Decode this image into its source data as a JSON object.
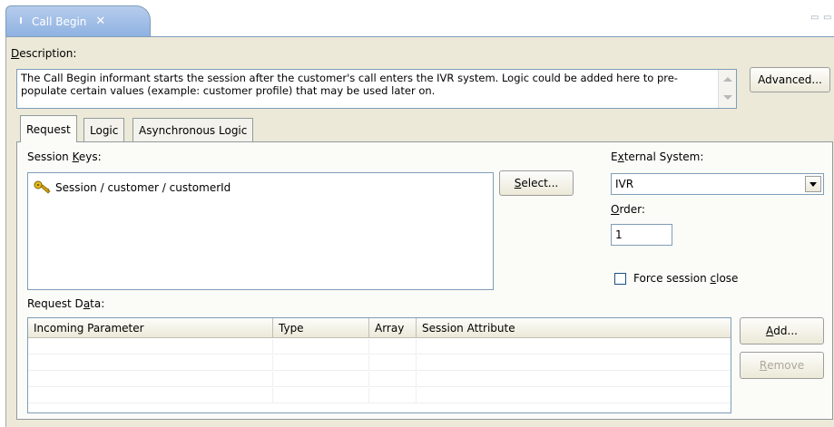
{
  "editor": {
    "tab_title": "Call Begin",
    "close_glyph": "✕",
    "minimize_glyph": "▭",
    "maximize_glyph": "▭"
  },
  "description": {
    "label_mnemonic": "D",
    "label_rest": "escription:",
    "text": "The Call Begin informant starts the session after the customer's call  enters the IVR system.  Logic could be added here to pre-populate certain values (example: customer profile) that may be used later on.",
    "advanced_button": "Advanced..."
  },
  "tabs": [
    {
      "label": "Request",
      "active": true
    },
    {
      "label": "Logic",
      "active": false
    },
    {
      "label": "Asynchronous Logic",
      "active": false
    }
  ],
  "session_keys": {
    "label_pre": "Session ",
    "label_mnemonic": "K",
    "label_rest": "eys:",
    "items": [
      "Session / customer / customerId"
    ],
    "select_button_mnemonic": "S",
    "select_button_rest": "elect..."
  },
  "external_system": {
    "label_pre": "E",
    "label_mnemonic": "x",
    "label_rest": "ternal System:",
    "selected": "IVR"
  },
  "order": {
    "label_mnemonic": "O",
    "label_rest": "rder:",
    "value": "1"
  },
  "force_close": {
    "label_pre": "Force session ",
    "label_mnemonic": "c",
    "label_rest": "lose",
    "checked": false
  },
  "request_data": {
    "label_pre": "Request D",
    "label_mnemonic": "a",
    "label_rest": "ta:",
    "columns": [
      "Incoming Parameter",
      "Type",
      "Array",
      "Session Attribute"
    ],
    "rows": [],
    "add_button_mnemonic": "A",
    "add_button_rest": "dd...",
    "remove_button_mnemonic": "R",
    "remove_button_rest": "emove"
  },
  "colors": {
    "tab_gradient_top": "#b6ccec",
    "tab_gradient_bottom": "#8fb2e2",
    "panel_bg": "#ece9d8",
    "field_border": "#7f9db9"
  }
}
